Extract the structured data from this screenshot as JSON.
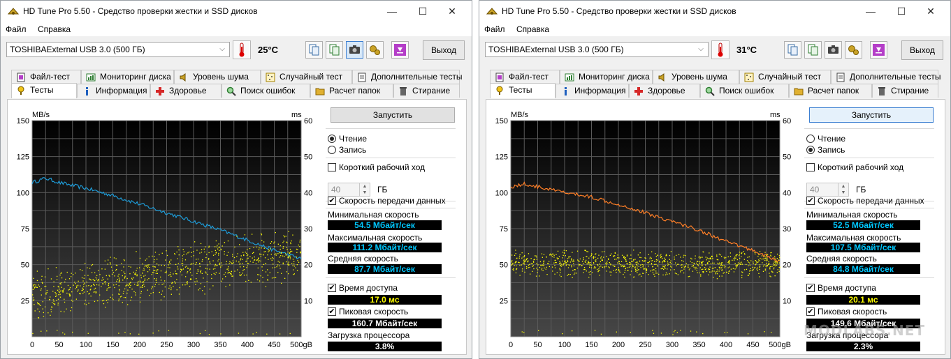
{
  "windows": [
    {
      "title": "HD Tune Pro 5.50 - Средство проверки жестки и SSD дисков",
      "menu": [
        "Файл",
        "Справка"
      ],
      "drive": "TOSHIBAExternal USB 3.0 (500 ГБ)",
      "temperature": "25°C",
      "exit_label": "Выход",
      "tabs_row1": [
        "Файл-тест",
        "Мониторинг диска",
        "Уровень шума",
        "Случайный тест",
        "Дополнительные тесты"
      ],
      "tabs_row2": [
        "Тесты",
        "Информация",
        "Здоровье",
        "Поиск ошибок",
        "Расчет папок",
        "Стирание"
      ],
      "active_tab": "Тесты",
      "start_label": "Запустить",
      "mode_read": "Чтение",
      "mode_write": "Запись",
      "selected_mode": "read",
      "short_stroke_label": "Короткий рабочий ход",
      "short_stroke_checked": false,
      "short_stroke_value": "40",
      "short_stroke_unit": "ГБ",
      "transfer_rate_label": "Скорость передачи данных",
      "transfer_rate_checked": true,
      "min_label": "Минимальная скорость",
      "min_value": "54.5 Мбайт/сек",
      "max_label": "Максимальная скорость",
      "max_value": "111.2 Мбайт/сек",
      "avg_label": "Средняя скорость",
      "avg_value": "87.7 Мбайт/сек",
      "access_label": "Время доступа",
      "access_checked": true,
      "access_value": "17.0 мс",
      "burst_label": "Пиковая скорость",
      "burst_checked": true,
      "burst_value": "160.7 Мбайт/сек",
      "cpu_label": "Загрузка процессора",
      "cpu_value": "3.8%",
      "chart_data": {
        "type": "line",
        "left_axis_unit": "MB/s",
        "right_axis_unit": "ms",
        "x_unit": "gB",
        "x_ticks": [
          "0",
          "50",
          "100",
          "150",
          "200",
          "250",
          "300",
          "350",
          "400",
          "450",
          "500gB"
        ],
        "y_left_ticks": [
          "150",
          "125",
          "100",
          "75",
          "50",
          "25"
        ],
        "y_right_ticks": [
          "60",
          "50",
          "40",
          "30",
          "20",
          "10"
        ],
        "y_left_range": [
          0,
          150
        ],
        "y_right_range": [
          0,
          60
        ],
        "x_range": [
          0,
          500
        ],
        "grid": true,
        "series": [
          {
            "kind": "line",
            "color": "#1e9bd7",
            "x": [
              0,
              25,
              50,
              100,
              150,
              200,
              250,
              300,
              350,
              400,
              450,
              500
            ],
            "y": [
              107,
              110,
              107,
              103,
              98,
              92,
              86,
              80,
              74,
              67,
              60,
              54
            ]
          },
          {
            "kind": "scatter",
            "color": "#ffff00",
            "trend_x": [
              0,
              100,
              200,
              300,
              400,
              500
            ],
            "trend_y_ms": [
              11,
              14,
              17,
              19,
              21,
              23
            ],
            "spread_ms": 8
          }
        ]
      }
    },
    {
      "title": "HD Tune Pro 5.50 - Средство проверки жестки и SSD дисков",
      "menu": [
        "Файл",
        "Справка"
      ],
      "drive": "TOSHIBAExternal USB 3.0 (500 ГБ)",
      "temperature": "31°C",
      "exit_label": "Выход",
      "tabs_row1": [
        "Файл-тест",
        "Мониторинг диска",
        "Уровень шума",
        "Случайный тест",
        "Дополнительные тесты"
      ],
      "tabs_row2": [
        "Тесты",
        "Информация",
        "Здоровье",
        "Поиск ошибок",
        "Расчет папок",
        "Стирание"
      ],
      "active_tab": "Тесты",
      "start_label": "Запустить",
      "mode_read": "Чтение",
      "mode_write": "Запись",
      "selected_mode": "write",
      "short_stroke_label": "Короткий рабочий ход",
      "short_stroke_checked": false,
      "short_stroke_value": "40",
      "short_stroke_unit": "ГБ",
      "transfer_rate_label": "Скорость передачи данных",
      "transfer_rate_checked": true,
      "min_label": "Минимальная скорость",
      "min_value": "52.5 Мбайт/сек",
      "max_label": "Максимальная скорость",
      "max_value": "107.5 Мбайт/сек",
      "avg_label": "Средняя скорость",
      "avg_value": "84.8 Мбайт/сек",
      "access_label": "Время доступа",
      "access_checked": true,
      "access_value": "20.1 мс",
      "burst_label": "Пиковая скорость",
      "burst_checked": true,
      "burst_value": "149.6 Мбайт/сек",
      "cpu_label": "Загрузка процессора",
      "cpu_value": "2.3%",
      "chart_data": {
        "type": "line",
        "left_axis_unit": "MB/s",
        "right_axis_unit": "ms",
        "x_unit": "gB",
        "x_ticks": [
          "0",
          "50",
          "100",
          "150",
          "200",
          "250",
          "300",
          "350",
          "400",
          "450",
          "500gB"
        ],
        "y_left_ticks": [
          "150",
          "125",
          "100",
          "75",
          "50",
          "25"
        ],
        "y_right_ticks": [
          "60",
          "50",
          "40",
          "30",
          "20",
          "10"
        ],
        "y_left_range": [
          0,
          150
        ],
        "y_right_range": [
          0,
          60
        ],
        "x_range": [
          0,
          500
        ],
        "grid": true,
        "series": [
          {
            "kind": "line",
            "color": "#ff7f27",
            "x": [
              0,
              25,
              50,
              100,
              150,
              200,
              250,
              300,
              350,
              400,
              450,
              500
            ],
            "y": [
              104,
              106,
              104,
              100,
              97,
              92,
              86,
              80,
              74,
              66,
              60,
              52
            ]
          },
          {
            "kind": "scatter",
            "color": "#ffff00",
            "trend_x": [
              0,
              500
            ],
            "trend_y_ms": [
              20.5,
              20
            ],
            "spread_ms": 4
          }
        ]
      }
    }
  ],
  "watermark": "MODLABS.NET"
}
